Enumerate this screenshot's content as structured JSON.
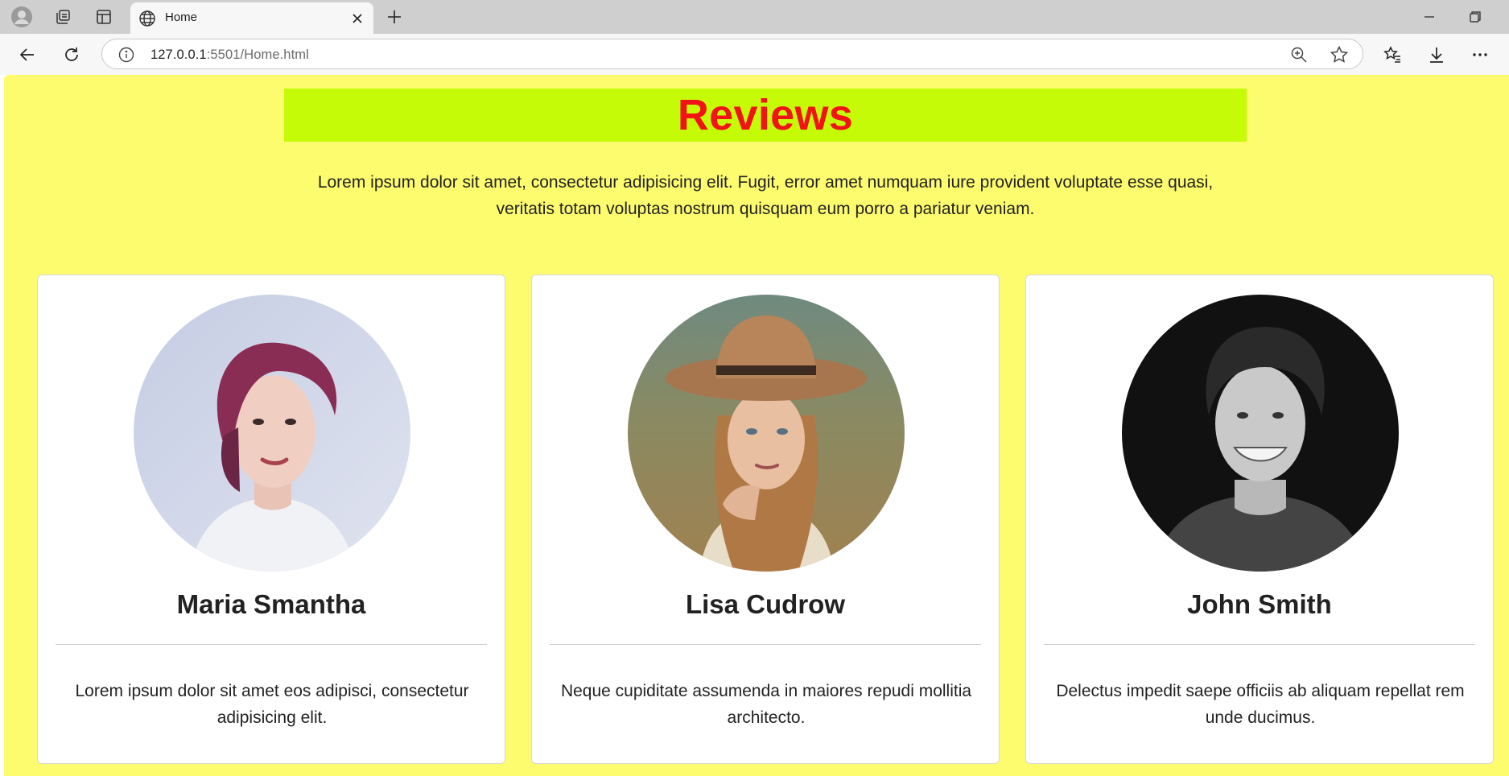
{
  "browser": {
    "tab_title": "Home",
    "url_host": "127.0.0.1",
    "url_rest": ":5501/Home.html"
  },
  "page": {
    "heading": "Reviews",
    "intro": "Lorem ipsum dolor sit amet, consectetur adipisicing elit. Fugit, error amet numquam iure provident voluptate esse quasi, veritatis totam voluptas nostrum quisquam eum porro a pariatur veniam.",
    "colors": {
      "background": "#fdfc6e",
      "heading_bar": "#c5fb07",
      "heading_text": "#f21317"
    }
  },
  "reviews": [
    {
      "name": "Maria Smantha",
      "text": "Lorem ipsum dolor sit amet eos adipisci, consectetur adipisicing elit."
    },
    {
      "name": "Lisa Cudrow",
      "text": "Neque cupiditate assumenda in maiores repudi mollitia architecto."
    },
    {
      "name": "John Smith",
      "text": "Delectus impedit saepe officiis ab aliquam repellat rem unde ducimus."
    }
  ]
}
